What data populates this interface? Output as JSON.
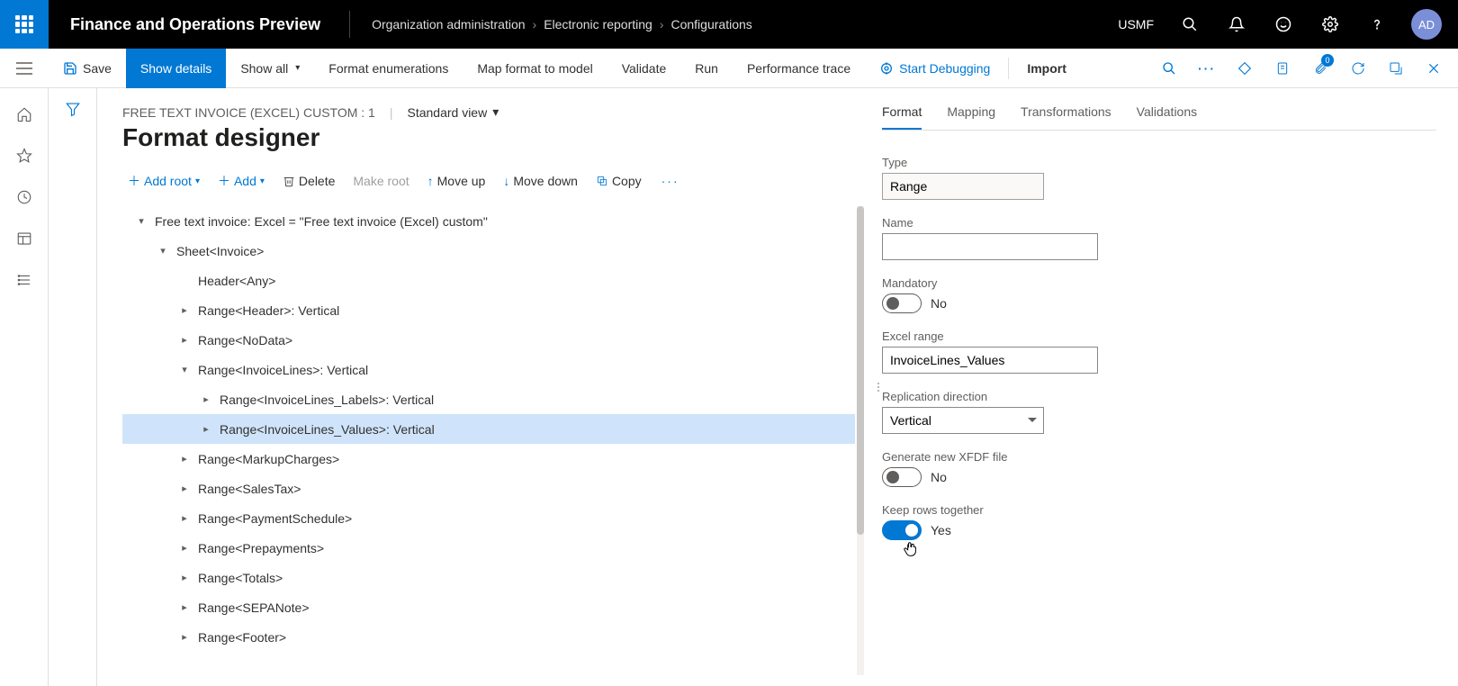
{
  "app_title": "Finance and Operations Preview",
  "company": "USMF",
  "avatar": "AD",
  "breadcrumbs": [
    "Organization administration",
    "Electronic reporting",
    "Configurations"
  ],
  "cmdbar": {
    "save": "Save",
    "show_details": "Show details",
    "show_all": "Show all",
    "format_enum": "Format enumerations",
    "map_format": "Map format to model",
    "validate": "Validate",
    "run": "Run",
    "perf_trace": "Performance trace",
    "start_debug": "Start Debugging",
    "import": "Import",
    "badge_count": "0"
  },
  "page": {
    "config_name": "FREE TEXT INVOICE (EXCEL) CUSTOM : 1",
    "view": "Standard view",
    "title": "Format designer"
  },
  "tree_toolbar": {
    "add_root": "Add root",
    "add": "Add",
    "delete": "Delete",
    "make_root": "Make root",
    "move_up": "Move up",
    "move_down": "Move down",
    "copy": "Copy"
  },
  "tree": [
    {
      "level": 0,
      "caret": "down",
      "label": "Free text invoice: Excel = \"Free text invoice (Excel) custom\"",
      "selected": false
    },
    {
      "level": 1,
      "caret": "down",
      "label": "Sheet<Invoice>",
      "selected": false
    },
    {
      "level": 2,
      "caret": "none",
      "label": "Header<Any>",
      "selected": false
    },
    {
      "level": 2,
      "caret": "right",
      "label": "Range<Header>: Vertical",
      "selected": false
    },
    {
      "level": 2,
      "caret": "right",
      "label": "Range<NoData>",
      "selected": false
    },
    {
      "level": 2,
      "caret": "down",
      "label": "Range<InvoiceLines>: Vertical",
      "selected": false
    },
    {
      "level": 3,
      "caret": "right",
      "label": "Range<InvoiceLines_Labels>: Vertical",
      "selected": false
    },
    {
      "level": 3,
      "caret": "right",
      "label": "Range<InvoiceLines_Values>: Vertical",
      "selected": true
    },
    {
      "level": 2,
      "caret": "right",
      "label": "Range<MarkupCharges>",
      "selected": false
    },
    {
      "level": 2,
      "caret": "right",
      "label": "Range<SalesTax>",
      "selected": false
    },
    {
      "level": 2,
      "caret": "right",
      "label": "Range<PaymentSchedule>",
      "selected": false
    },
    {
      "level": 2,
      "caret": "right",
      "label": "Range<Prepayments>",
      "selected": false
    },
    {
      "level": 2,
      "caret": "right",
      "label": "Range<Totals>",
      "selected": false
    },
    {
      "level": 2,
      "caret": "right",
      "label": "Range<SEPANote>",
      "selected": false
    },
    {
      "level": 2,
      "caret": "right",
      "label": "Range<Footer>",
      "selected": false
    }
  ],
  "tabs": [
    "Format",
    "Mapping",
    "Transformations",
    "Validations"
  ],
  "active_tab": 0,
  "form": {
    "type_label": "Type",
    "type_value": "Range",
    "name_label": "Name",
    "name_value": "",
    "mandatory_label": "Mandatory",
    "mandatory_value": "No",
    "excel_range_label": "Excel range",
    "excel_range_value": "InvoiceLines_Values",
    "replication_label": "Replication direction",
    "replication_value": "Vertical",
    "xfdf_label": "Generate new XFDF file",
    "xfdf_value": "No",
    "keep_rows_label": "Keep rows together",
    "keep_rows_value": "Yes"
  }
}
